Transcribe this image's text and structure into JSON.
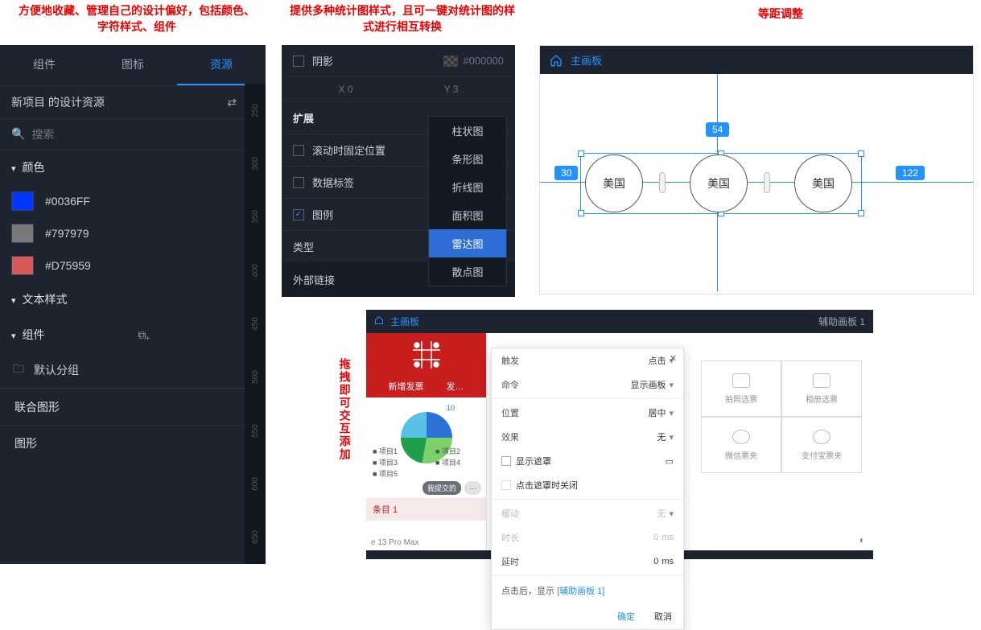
{
  "captions": {
    "c1": "方便地收藏、管理自己的设计偏好，包括颜色、字符样式、组件",
    "c2": "提供多种统计图样式，且可一键对统计图的样式进行相互转换",
    "c3": "等距调整",
    "c4": "拖拽即可交互添加"
  },
  "panel1": {
    "tabs": [
      "组件",
      "图标",
      "资源"
    ],
    "active_tab": 2,
    "title": "新项目 的设计资源",
    "search_placeholder": "搜索",
    "section_colors": "颜色",
    "colors": [
      {
        "hex": "#0036FF"
      },
      {
        "hex": "#797979"
      },
      {
        "hex": "#D75959"
      }
    ],
    "section_text": "文本样式",
    "section_components": "组件",
    "folder_default": "默认分组",
    "comp_items": [
      "联合图形",
      "图形"
    ],
    "ruler": [
      "250",
      "300",
      "350",
      "400",
      "450",
      "500",
      "550",
      "600",
      "650"
    ]
  },
  "panel2": {
    "shadow_label": "阴影",
    "shadow_color": "#000000",
    "xy": {
      "xl": "X",
      "xv": "0",
      "yl": "Y",
      "yv": "3"
    },
    "section_ext": "扩展",
    "opt_scroll_fix": "滚动时固定位置",
    "opt_data_label": "数据标签",
    "opt_legend": "图例",
    "type_label": "类型",
    "type_value": "雷达图",
    "ext_link": "外部链接",
    "menu": [
      "柱状图",
      "条形图",
      "折线图",
      "面积图",
      "雷达图",
      "散点图"
    ],
    "menu_sel": 4
  },
  "panel3": {
    "breadcrumb": "主画板",
    "tag_top": "54",
    "tag_left": "30",
    "tag_right": "122",
    "circle_label": "美国"
  },
  "panel4": {
    "breadcrumb": "主画板",
    "aux_label": "辅助画板  1",
    "red_tab_a": "新增发票",
    "red_tab_b": "发…",
    "legend": [
      "项目1",
      "项目2",
      "项目3",
      "项目4",
      "项目5"
    ],
    "pie_num": "10",
    "pill_btn": "我提交的",
    "strip": "条目 1",
    "device": "e 13 Pro Max",
    "dialog": {
      "trigger_l": "触发",
      "trigger_v": "点击",
      "cmd_l": "命令",
      "cmd_v": "显示画板",
      "pos_l": "位置",
      "pos_v": "居中",
      "fx_l": "效果",
      "fx_v": "无",
      "mask_l": "显示遮罩",
      "close_l": "点击遮罩时关闭",
      "ease_l": "缓动",
      "ease_v": "无",
      "dur_l": "时长",
      "dur_v": "0",
      "unit": "ms",
      "delay_l": "延时",
      "delay_v": "0",
      "hint_a": "点击后，显示",
      "hint_link": "[辅助画板 1]",
      "ok": "确定",
      "cancel": "取消"
    },
    "aux_cells": [
      "拍照选票",
      "相册选票",
      "微信票夹",
      "支付宝票夹"
    ]
  },
  "chart_data": {
    "type": "pie",
    "title": "",
    "series": [
      {
        "name": "项目1",
        "value": 25
      },
      {
        "name": "项目2",
        "value": 28
      },
      {
        "name": "项目3",
        "value": 22
      },
      {
        "name": "项目4",
        "value": 15
      },
      {
        "name": "项目5",
        "value": 10
      }
    ]
  }
}
